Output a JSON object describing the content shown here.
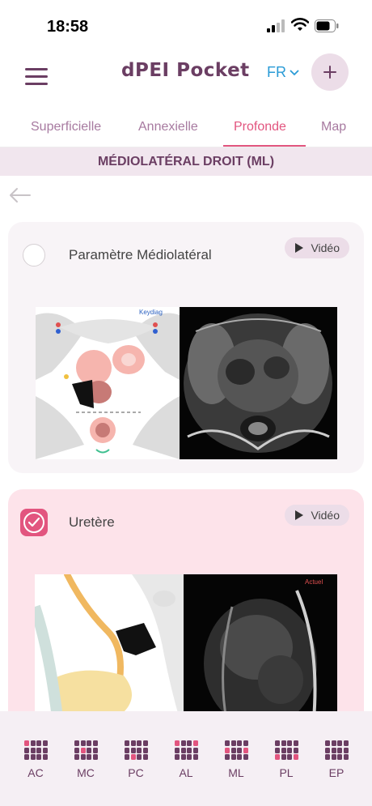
{
  "status_bar": {
    "time": "18:58"
  },
  "header": {
    "title": "dPEI Pocket",
    "language": "FR"
  },
  "tabs": [
    {
      "label": "Superficielle"
    },
    {
      "label": "Annexielle"
    },
    {
      "label": "Profonde"
    },
    {
      "label": "Map"
    }
  ],
  "active_tab": "Profonde",
  "section_title": "MÉDIOLATÉRAL DROIT (ML)",
  "cards": [
    {
      "title": "Paramètre Médiolatéral",
      "video_label": "Vidéo",
      "checked": false,
      "brand": "Keydiag"
    },
    {
      "title": "Uretère",
      "video_label": "Vidéo",
      "checked": true,
      "mri_caption": "Actuel"
    }
  ],
  "bottom_nav": [
    {
      "label": "AC"
    },
    {
      "label": "MC"
    },
    {
      "label": "PC"
    },
    {
      "label": "AL"
    },
    {
      "label": "ML"
    },
    {
      "label": "PL"
    },
    {
      "label": "EP"
    }
  ],
  "colors": {
    "accent": "#e2557f",
    "brand": "#6b3e63",
    "link": "#2a9bd6"
  }
}
